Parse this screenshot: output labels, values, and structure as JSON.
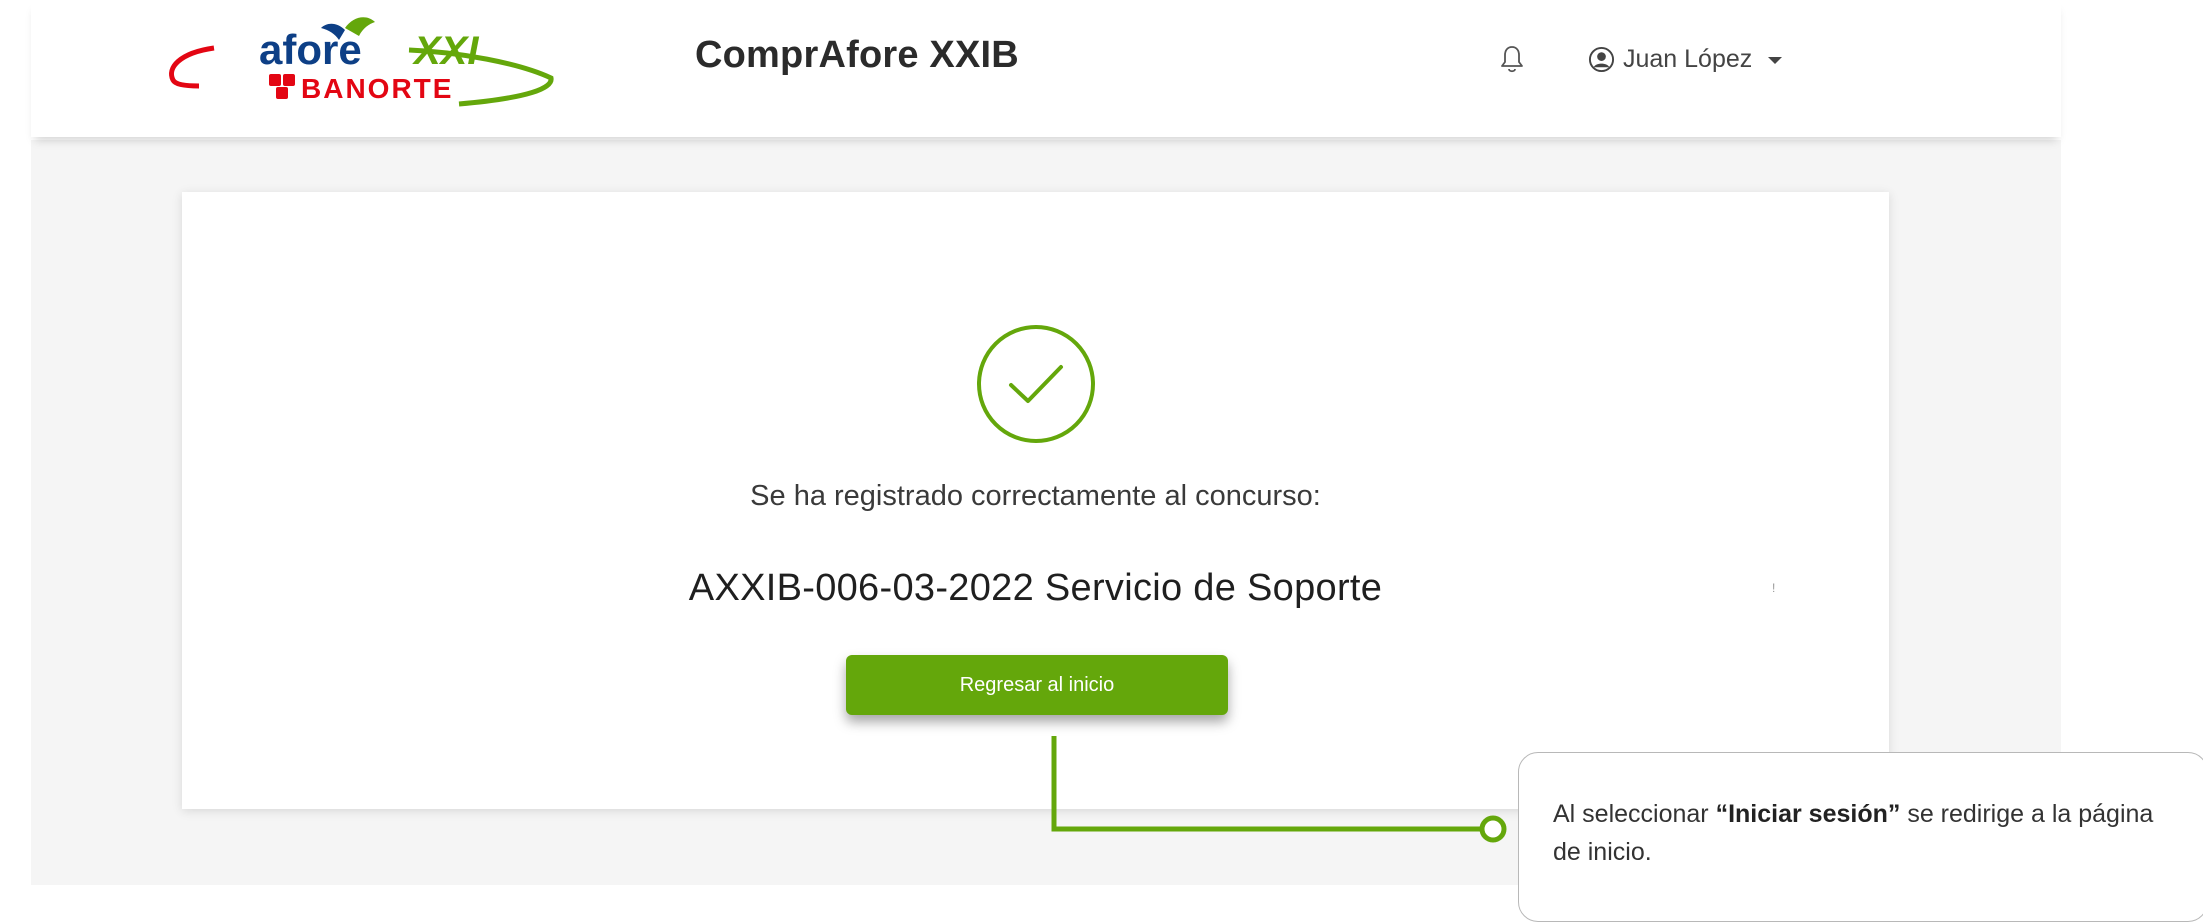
{
  "header": {
    "logo_top": "afore",
    "logo_xxi": "XXI",
    "logo_bottom": "BANORTE",
    "app_title": "ComprAfore XXIB",
    "user_name": "Juan López"
  },
  "icons": {
    "bell": "bell-icon",
    "user": "user-circle-icon",
    "caret": "caret-down-icon",
    "success": "check-circle-icon"
  },
  "colors": {
    "brand_green": "#64a70b",
    "brand_red": "#e30613",
    "logo_blue": "#0d3f86"
  },
  "main": {
    "success_message": "Se ha registrado correctamente al concurso:",
    "contest_name": "AXXIB-006-03-2022 Servicio de Soporte",
    "return_button_label": "Regresar al inicio"
  },
  "callout": {
    "prefix": "Al seleccionar ",
    "highlight": "“Iniciar sesión”",
    "suffix": " se redirige a la página de inicio."
  }
}
